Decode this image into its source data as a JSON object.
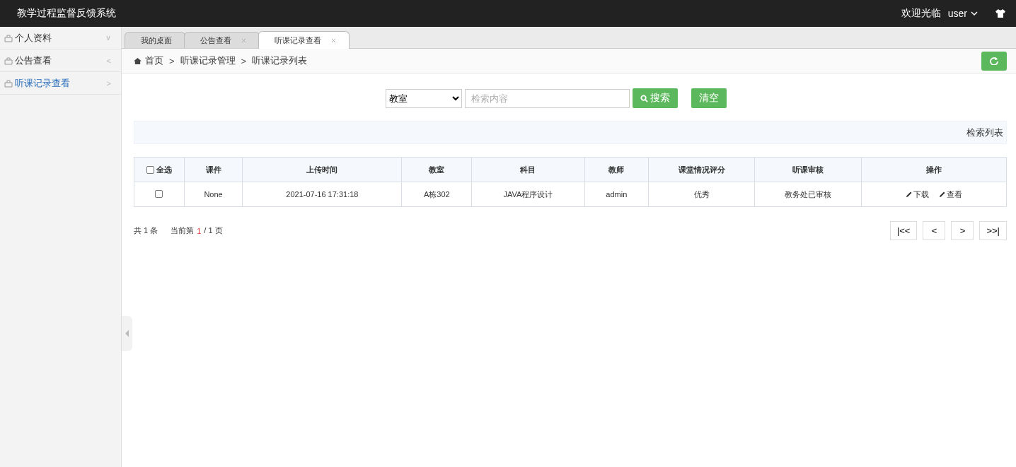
{
  "header": {
    "title": "教学过程监督反馈系统",
    "welcome": "欢迎光临",
    "user": "user"
  },
  "sidebar": {
    "items": [
      {
        "label": "个人资料",
        "caret": "∨",
        "selected": false
      },
      {
        "label": "公告查看",
        "caret": "<",
        "selected": false
      },
      {
        "label": "听课记录查看",
        "caret": ">",
        "selected": true
      }
    ]
  },
  "tabs": [
    {
      "label": "我的桌面",
      "closable": false,
      "selected": false
    },
    {
      "label": "公告查看",
      "closable": true,
      "selected": false
    },
    {
      "label": "听课记录查看",
      "closable": true,
      "selected": true
    }
  ],
  "breadcrumb": [
    {
      "kind": "home",
      "text": "首页"
    },
    {
      "kind": "separator",
      "text": ">"
    },
    {
      "kind": "link",
      "text": "听课记录管理"
    },
    {
      "kind": "separator",
      "text": ">"
    },
    {
      "kind": "current",
      "text": "听课记录列表"
    }
  ],
  "search": {
    "field": "教室",
    "placeholder": "检索内容",
    "search_button": "搜索",
    "clear_button": "清空"
  },
  "panel_title": "检索列表",
  "table": {
    "select_all": {
      "label": "全选",
      "checked": false
    },
    "columns": [
      "课件",
      "上传时间",
      "教室",
      "科目",
      "教师",
      "课堂情况评分",
      "听课审核",
      "操作"
    ],
    "rows": [
      {
        "checked": false,
        "cells": [
          "None",
          "2021-07-16 17:31:18",
          "A栋302",
          "JAVA程序设计",
          "admin",
          "优秀",
          "教务处已审核"
        ],
        "actions": [
          "下载",
          "查看"
        ]
      }
    ]
  },
  "pagination": {
    "total": "共 1 条",
    "page_prefix": "当前第",
    "current": "1",
    "page_suffix": "/ 1 页",
    "buttons": [
      "|<<",
      "<",
      ">",
      ">>|"
    ]
  }
}
